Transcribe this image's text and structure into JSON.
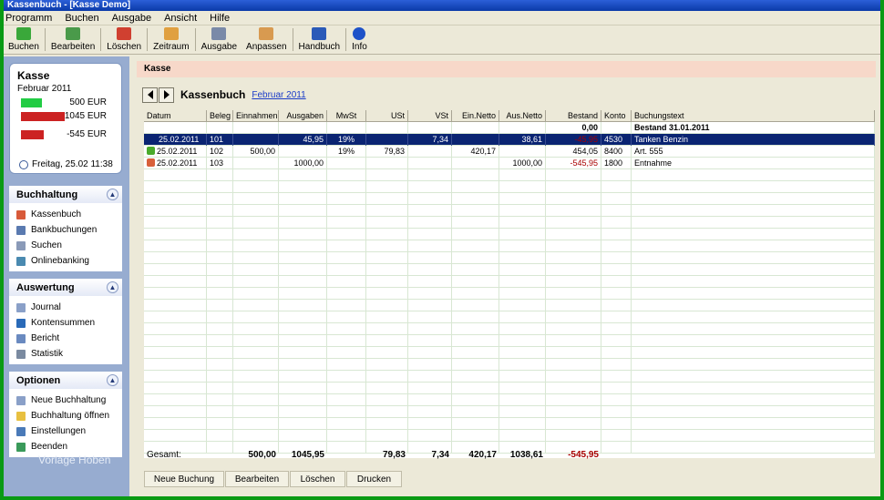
{
  "window": {
    "title": "Kassenbuch - [Kasse Demo]"
  },
  "menu": [
    "Programm",
    "Buchen",
    "Ausgabe",
    "Ansicht",
    "Hilfe"
  ],
  "toolbar": [
    {
      "label": "Buchen",
      "icon": "book-entry-icon",
      "color": "#3aa83a"
    },
    {
      "label": "Bearbeiten",
      "icon": "edit-icon",
      "color": "#4a9a4a"
    },
    {
      "label": "Löschen",
      "icon": "delete-icon",
      "color": "#d04030"
    },
    {
      "label": "Zeitraum",
      "icon": "calendar-icon",
      "color": "#e0a040"
    },
    {
      "label": "Ausgabe",
      "icon": "printer-icon",
      "color": "#7a8aa8"
    },
    {
      "label": "Anpassen",
      "icon": "adjust-icon",
      "color": "#d89a50"
    },
    {
      "label": "Handbuch",
      "icon": "manual-icon",
      "color": "#2a5ab8"
    },
    {
      "label": "Info",
      "icon": "info-icon",
      "color": "#1e52c8"
    }
  ],
  "kasse": {
    "title": "Kasse",
    "period": "Februar 2011",
    "bars": [
      {
        "value": "500 EUR",
        "color": "#22cc44",
        "fraction": 0.48
      },
      {
        "value": "1045 EUR",
        "color": "#cc2222",
        "fraction": 1.0
      },
      {
        "value": "-545 EUR",
        "color": "#cc2222",
        "fraction": 0.52
      }
    ],
    "clock": "Freitag, 25.02   11:38"
  },
  "groups": [
    {
      "title": "Buchhaltung",
      "items": [
        {
          "label": "Kassenbuch",
          "icon": "cashbook-icon",
          "color": "#d85a3a"
        },
        {
          "label": "Bankbuchungen",
          "icon": "bank-icon",
          "color": "#5a7ab0"
        },
        {
          "label": "Suchen",
          "icon": "search-icon",
          "color": "#8a9ab8"
        },
        {
          "label": "Onlinebanking",
          "icon": "online-banking-icon",
          "color": "#4a8ab0"
        }
      ]
    },
    {
      "title": "Auswertung",
      "items": [
        {
          "label": "Journal",
          "icon": "journal-icon",
          "color": "#8aa0c8"
        },
        {
          "label": "Kontensummen",
          "icon": "account-sums-icon",
          "color": "#2a6ab8"
        },
        {
          "label": "Bericht",
          "icon": "report-icon",
          "color": "#6a8ac0"
        },
        {
          "label": "Statistik",
          "icon": "statistics-icon",
          "color": "#7a8aa0"
        }
      ]
    },
    {
      "title": "Optionen",
      "items": [
        {
          "label": "Neue Buchhaltung",
          "icon": "new-ledger-icon",
          "color": "#8aa0c8"
        },
        {
          "label": "Buchhaltung öffnen",
          "icon": "open-folder-icon",
          "color": "#e8c040"
        },
        {
          "label": "Einstellungen",
          "icon": "settings-icon",
          "color": "#4a7ab8"
        },
        {
          "label": "Beenden",
          "icon": "exit-icon",
          "color": "#3a9a5a"
        }
      ]
    }
  ],
  "sidebar_watermark": "Vorlage Hoben",
  "panel": {
    "header": "Kasse",
    "title": "Kassenbuch",
    "period_link": "Februar 2011"
  },
  "table": {
    "columns": [
      "Datum",
      "Beleg",
      "Einnahmen",
      "Ausgaben",
      "MwSt",
      "USt",
      "VSt",
      "Ein.Netto",
      "Aus.Netto",
      "Bestand",
      "Konto",
      "Buchungstext"
    ],
    "opening": {
      "bestand": "0,00",
      "text": "Bestand 31.01.2011"
    },
    "rows": [
      {
        "datum": "25.02.2011",
        "beleg": "101",
        "einnahmen": "",
        "ausgaben": "45,95",
        "mwst": "19%",
        "ust": "",
        "vst": "7,34",
        "ein_netto": "",
        "aus_netto": "38,61",
        "bestand": "-45,95",
        "konto": "4530",
        "text": "Tanken Benzin",
        "selected": true,
        "icon": ""
      },
      {
        "datum": "25.02.2011",
        "beleg": "102",
        "einnahmen": "500,00",
        "ausgaben": "",
        "mwst": "19%",
        "ust": "79,83",
        "vst": "",
        "ein_netto": "420,17",
        "aus_netto": "",
        "bestand": "454,05",
        "konto": "8400",
        "text": "Art. 555",
        "selected": false,
        "icon": "income-icon"
      },
      {
        "datum": "25.02.2011",
        "beleg": "103",
        "einnahmen": "",
        "ausgaben": "1000,00",
        "mwst": "",
        "ust": "",
        "vst": "",
        "ein_netto": "",
        "aus_netto": "1000,00",
        "bestand": "-545,95",
        "konto": "1800",
        "text": "Entnahme",
        "selected": false,
        "icon": "withdrawal-icon"
      }
    ],
    "totals": {
      "label": "Gesamt:",
      "einnahmen": "500,00",
      "ausgaben": "1045,95",
      "ust": "79,83",
      "vst": "7,34",
      "ein_netto": "420,17",
      "aus_netto": "1038,61",
      "bestand": "-545,95"
    }
  },
  "bottom_buttons": [
    "Neue Buchung",
    "Bearbeiten",
    "Löschen",
    "Drucken"
  ]
}
